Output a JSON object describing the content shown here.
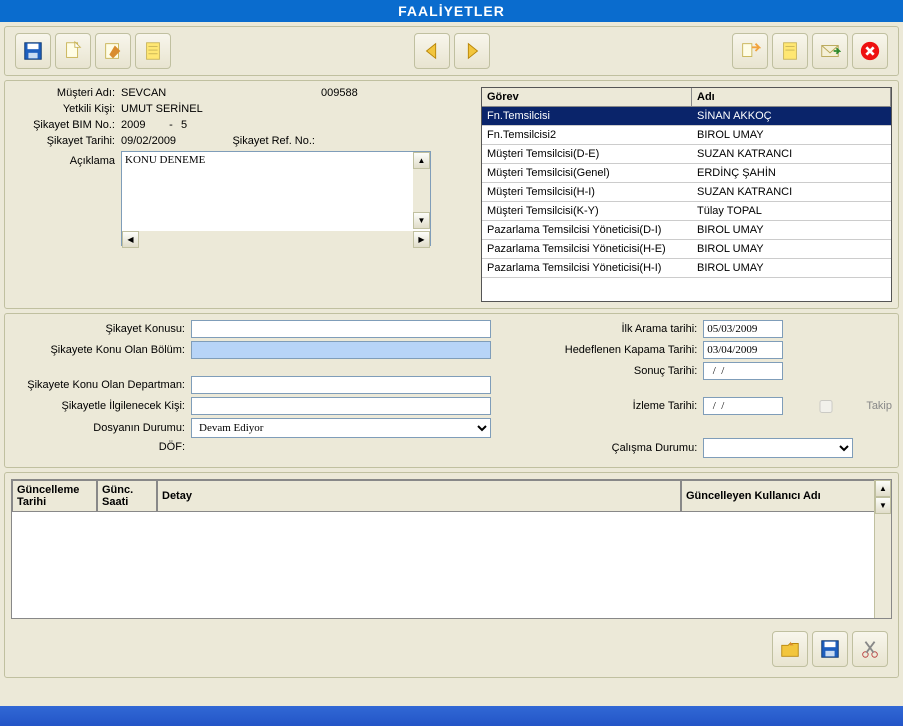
{
  "window": {
    "title": "FAALİYETLER"
  },
  "customer": {
    "name_label": "Müşteri Adı:",
    "name": "SEVCAN",
    "code": "009588",
    "contact_label": "Yetkili Kişi:",
    "contact": "UMUT SERİNEL",
    "bim_label": "Şikayet BIM No.:",
    "bim_year": "2009",
    "bim_sep": "-",
    "bim_no": "5",
    "date_label": "Şikayet Tarihi:",
    "date": "09/02/2009",
    "ref_label": "Şikayet Ref. No.:",
    "desc_label": "Açıklama",
    "desc": "KONU DENEME"
  },
  "roles": {
    "head_gorev": "Görev",
    "head_adi": "Adı",
    "rows": [
      {
        "g": "Fn.Temsilcisi",
        "a": "SİNAN AKKOÇ",
        "sel": true
      },
      {
        "g": "Fn.Temsilcisi2",
        "a": "BIROL UMAY"
      },
      {
        "g": "Müşteri Temsilcisi(D-E)",
        "a": "SUZAN KATRANCI"
      },
      {
        "g": "Müşteri Temsilcisi(Genel)",
        "a": "ERDİNÇ ŞAHİN"
      },
      {
        "g": "Müşteri Temsilcisi(H-I)",
        "a": "SUZAN KATRANCI"
      },
      {
        "g": "Müşteri Temsilcisi(K-Y)",
        "a": "Tülay TOPAL"
      },
      {
        "g": "Pazarlama Temsilcisi Yöneticisi(D-I)",
        "a": "BIROL UMAY"
      },
      {
        "g": "Pazarlama Temsilcisi Yöneticisi(H-E)",
        "a": "BIROL UMAY"
      },
      {
        "g": "Pazarlama Temsilcisi Yöneticisi(H-I)",
        "a": "BIROL UMAY"
      }
    ]
  },
  "form": {
    "subject_label": "Şikayet Konusu:",
    "subject": "",
    "section_label": "Şikayete Konu Olan Bölüm:",
    "section": "",
    "dept_label": "Şikayete Konu Olan Departman:",
    "dept": "",
    "person_label": "Şikayetle İlgilenecek Kişi:",
    "person": "",
    "status_label": "Dosyanın Durumu:",
    "status": "Devam Ediyor",
    "dof_label": "DÖF:",
    "first_call_label": "İlk Arama tarihi:",
    "first_call": "05/03/2009",
    "target_close_label": "Hedeflenen Kapama Tarihi:",
    "target_close": "03/04/2009",
    "result_date_label": "Sonuç Tarihi:",
    "result_date": "  /  /",
    "track_date_label": "İzleme Tarihi:",
    "track_date": "  /  /",
    "track_chk_label": "Takip",
    "work_status_label": "Çalışma Durumu:"
  },
  "updates": {
    "col_date": "Güncelleme Tarihi",
    "col_time": "Günc. Saati",
    "col_detail": "Detay",
    "col_user": "Güncelleyen Kullanıcı Adı"
  }
}
